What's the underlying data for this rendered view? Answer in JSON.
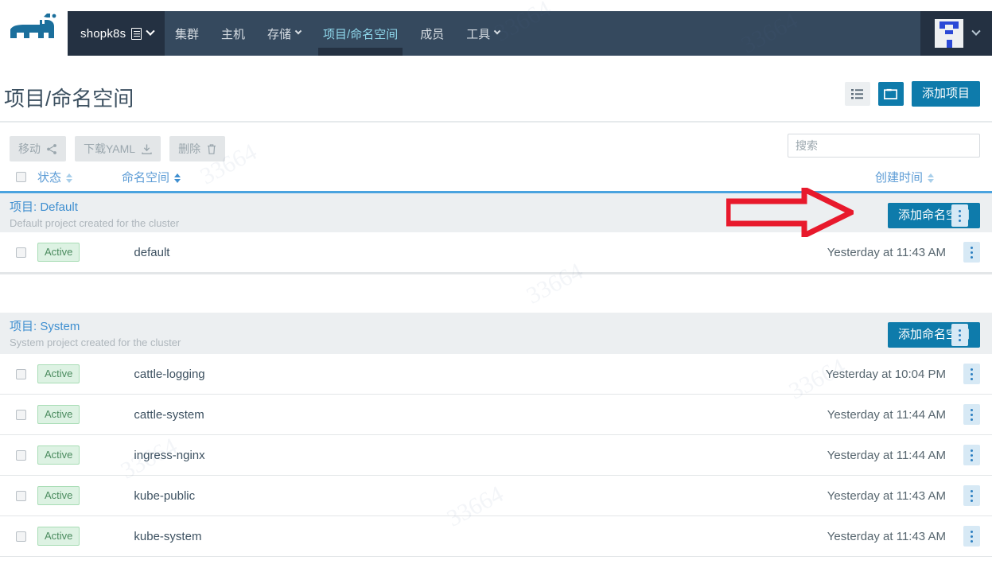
{
  "header": {
    "logo_icon": "rancher-cow-logo",
    "cluster_selector": {
      "name": "shopk8s",
      "icon": "server-list-icon",
      "caret_icon": "chevron-down-icon"
    },
    "nav_items": [
      {
        "label": "集群",
        "active": false,
        "has_caret": false
      },
      {
        "label": "主机",
        "active": false,
        "has_caret": false
      },
      {
        "label": "存储",
        "active": false,
        "has_caret": true
      },
      {
        "label": "项目/命名空间",
        "active": true,
        "has_caret": false
      },
      {
        "label": "成员",
        "active": false,
        "has_caret": false
      },
      {
        "label": "工具",
        "active": false,
        "has_caret": true
      }
    ],
    "avatar_icon": "user-identicon-avatar",
    "avatar_caret_icon": "chevron-down-icon"
  },
  "page": {
    "title": "项目/命名空间",
    "view_list_icon": "list-view-icon",
    "view_group_icon": "folder-view-icon",
    "add_project_label": "添加项目"
  },
  "toolbar": {
    "move_label": "移动",
    "move_icon": "share-icon",
    "download_label": "下载YAML",
    "download_icon": "download-icon",
    "delete_label": "删除",
    "delete_icon": "trash-icon",
    "search_placeholder": "搜索",
    "search_value": ""
  },
  "columns": {
    "select_all_checkbox": "",
    "state": "状态",
    "namespace": "命名空间",
    "created": "创建时间"
  },
  "annotation": {
    "type": "red-arrow-pointing-right",
    "color": "#e8192c",
    "target": "添加命名空间"
  },
  "colors": {
    "navbar_bg": "#35495e",
    "navbar_dark": "#243142",
    "accent": "#0e7bab",
    "link": "#3f8fd0",
    "active_tab": "#8fd8ec",
    "badge_green": "#4a8b5e",
    "annotation_red": "#e8192c"
  },
  "groups": [
    {
      "title_label": "项目: ",
      "title_name": "Default",
      "description": "Default project created for the cluster",
      "add_namespace_label": "添加命名空间",
      "kebab_icon": "kebab-menu-icon",
      "rows": [
        {
          "state": "Active",
          "namespace": "default",
          "created": "Yesterday at 11:43 AM"
        }
      ]
    },
    {
      "title_label": "项目: ",
      "title_name": "System",
      "description": "System project created for the cluster",
      "add_namespace_label": "添加命名空间",
      "kebab_icon": "kebab-menu-icon",
      "rows": [
        {
          "state": "Active",
          "namespace": "cattle-logging",
          "created": "Yesterday at 10:04 PM"
        },
        {
          "state": "Active",
          "namespace": "cattle-system",
          "created": "Yesterday at 11:44 AM"
        },
        {
          "state": "Active",
          "namespace": "ingress-nginx",
          "created": "Yesterday at 11:44 AM"
        },
        {
          "state": "Active",
          "namespace": "kube-public",
          "created": "Yesterday at 11:43 AM"
        },
        {
          "state": "Active",
          "namespace": "kube-system",
          "created": "Yesterday at 11:43 AM"
        }
      ]
    }
  ]
}
